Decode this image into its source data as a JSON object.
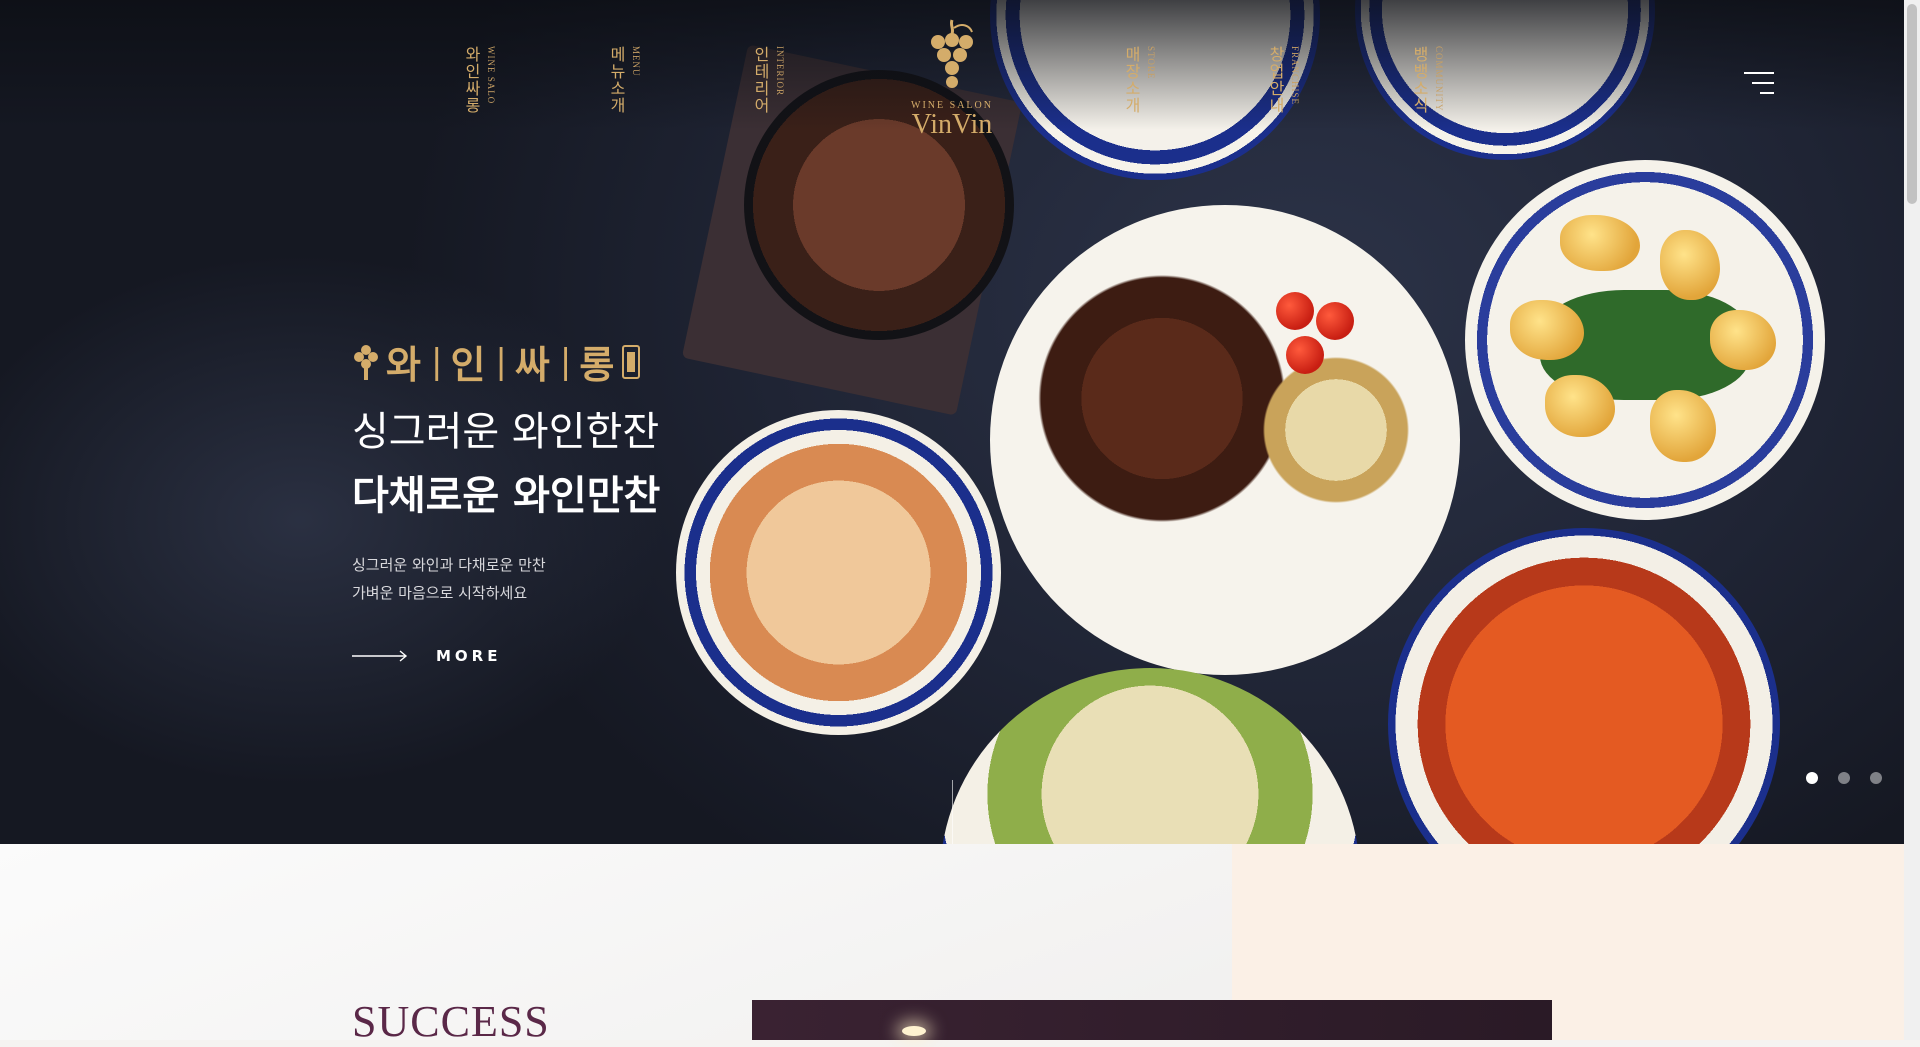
{
  "nav": {
    "items": [
      {
        "ko": "와인싸롱",
        "en": "WINE SALO"
      },
      {
        "ko": "메뉴소개",
        "en": "MENU"
      },
      {
        "ko": "인테리어",
        "en": "INTERIOR"
      },
      {
        "ko": "매장소개",
        "en": "STORE"
      },
      {
        "ko": "창업안내",
        "en": "FRANCHISE"
      },
      {
        "ko": "뱅뱅소식",
        "en": "COMMUNITY"
      }
    ],
    "logo_sub": "WINE SALON",
    "logo_main": "VinVin",
    "menu_icon": "hamburger-menu-icon"
  },
  "hero": {
    "brand_chars": [
      "와",
      "인",
      "싸",
      "롱"
    ],
    "headline_1": "싱그러운 와인한잔",
    "headline_2": "다채로운 와인만찬",
    "desc_1": "싱그러운 와인과 다채로운 만찬",
    "desc_2": "가벼운 마음으로 시작하세요",
    "more_label": "MORE",
    "slides_total": 3,
    "slide_active": 1
  },
  "section": {
    "title": "SUCCESS"
  },
  "colors": {
    "gold": "#d4ac6a",
    "hero_bg": "#1f2434",
    "plum": "#5a2848",
    "cream": "#fbf0e6"
  }
}
